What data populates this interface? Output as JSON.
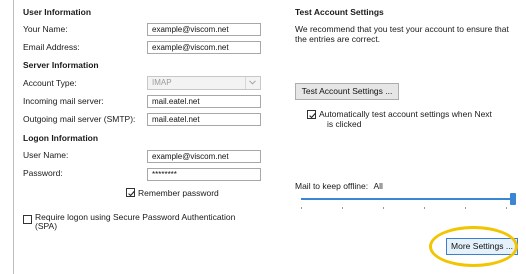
{
  "user_info": {
    "header": "User Information",
    "your_name_label": "Your Name:",
    "your_name_value": "example@viscom.net",
    "email_label": "Email Address:",
    "email_value": "example@viscom.net"
  },
  "server_info": {
    "header": "Server Information",
    "account_type_label": "Account Type:",
    "account_type_value": "IMAP",
    "incoming_label": "Incoming mail server:",
    "incoming_value": "mail.eatel.net",
    "outgoing_label": "Outgoing mail server (SMTP):",
    "outgoing_value": "mail.eatel.net"
  },
  "logon_info": {
    "header": "Logon Information",
    "username_label": "User Name:",
    "username_value": "example@viscom.net",
    "password_label": "Password:",
    "password_value": "********",
    "remember_label": "Remember password",
    "remember_checked": true,
    "spa_label_line1": "Require logon using Secure Password Authentication",
    "spa_label_line2": "(SPA)",
    "spa_checked": false
  },
  "test_settings": {
    "header": "Test Account Settings",
    "description_line1": "We recommend that you test your account to ensure that",
    "description_line2": "the entries are correct.",
    "test_button_label": "Test Account Settings ...",
    "auto_test_label_line1": "Automatically test account settings when Next",
    "auto_test_label_line2": "is clicked",
    "auto_test_checked": true
  },
  "offline": {
    "label": "Mail to keep offline:",
    "value": "All",
    "slider_level": 1.0
  },
  "more_settings_button_label": "More Settings ...",
  "colors": {
    "accent": "#3b86d4",
    "highlight": "#f3c400"
  }
}
